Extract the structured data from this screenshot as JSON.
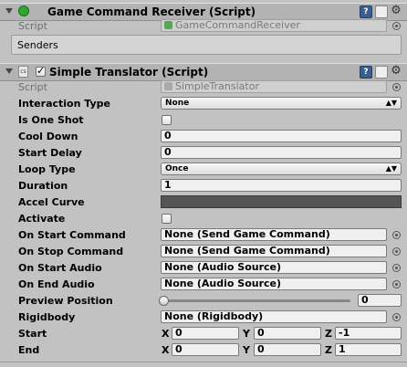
{
  "receiver": {
    "title": "Game Command Receiver (Script)",
    "script_label": "Script",
    "script_value": "GameCommandReceiver",
    "senders_label": "Senders"
  },
  "translator": {
    "title": "Simple Translator (Script)",
    "enabled": true,
    "script_label": "Script",
    "script_value": "SimpleTranslator",
    "interaction_type": {
      "label": "Interaction Type",
      "value": "None"
    },
    "is_one_shot": {
      "label": "Is One Shot",
      "checked": false
    },
    "cool_down": {
      "label": "Cool Down",
      "value": "0"
    },
    "start_delay": {
      "label": "Start Delay",
      "value": "0"
    },
    "loop_type": {
      "label": "Loop Type",
      "value": "Once"
    },
    "duration": {
      "label": "Duration",
      "value": "1"
    },
    "accel_curve": {
      "label": "Accel Curve"
    },
    "activate": {
      "label": "Activate",
      "checked": false
    },
    "on_start_command": {
      "label": "On Start Command",
      "value": "None (Send Game Command)"
    },
    "on_stop_command": {
      "label": "On Stop Command",
      "value": "None (Send Game Command)"
    },
    "on_start_audio": {
      "label": "On Start Audio",
      "value": "None (Audio Source)"
    },
    "on_end_audio": {
      "label": "On End Audio",
      "value": "None (Audio Source)"
    },
    "preview_position": {
      "label": "Preview Position",
      "value": "0"
    },
    "rigidbody": {
      "label": "Rigidbody",
      "value": "None (Rigidbody)"
    },
    "start": {
      "label": "Start",
      "x": "0",
      "y": "0",
      "z": "-1"
    },
    "end": {
      "label": "End",
      "x": "0",
      "y": "0",
      "z": "1"
    },
    "axis_labels": {
      "x": "X",
      "y": "Y",
      "z": "Z"
    }
  },
  "icons": {
    "help": "?",
    "gear": "⚙"
  },
  "colors": {
    "inspector_bg": "#c2c2c2",
    "header_bg": "#b3b3b3",
    "receiver_dot": "#2fa82f",
    "curve_field": "#555555"
  }
}
